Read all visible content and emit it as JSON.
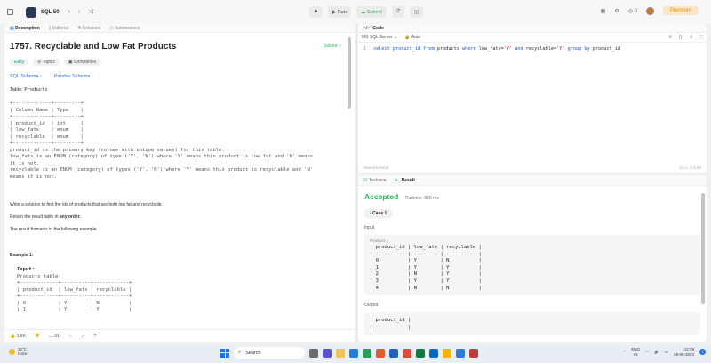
{
  "nav": {
    "title": "SQL 50",
    "run_label": "Run",
    "submit_label": "Submit",
    "streak": "0",
    "premium_label": "Premium"
  },
  "left": {
    "tabs": [
      "Description",
      "Editorial",
      "Solutions",
      "Submissions"
    ],
    "title": "1757. Recyclable and Low Fat Products",
    "solved": "Solved",
    "tags": [
      "Easy",
      "Topics",
      "Companies"
    ],
    "schemas": [
      "SQL Schema",
      "Pandas Schema"
    ],
    "table_label": "Table: ",
    "table_name": "Products",
    "schema_block": "+-------------+---------+\n| Column Name | Type    |\n+-------------+---------+\n| product_id  | int     |\n| low_fats    | enum    |\n| recyclable  | enum    |\n+-------------+---------+\nproduct_id is the primary key (column with unique values) for this table.\nlow_fats is an ENUM (category) of type ('Y', 'N') where 'Y' means this product is low fat and 'N' means\nit is not.\nrecyclable is an ENUM (category) of types ('Y', 'N') where 'Y' means this product is recyclable and 'N'\nmeans it is not.",
    "task": "Write a solution to find the ids of products that are both low fat and recyclable.",
    "order_pre": "Return the result table in ",
    "order_bold": "any order",
    "order_post": ".",
    "format": "The result format is in the following example.",
    "example_title": "Example 1:",
    "input_label": "Input:",
    "input_table_label": "Products table:",
    "example_block": "+-------------+----------+------------+\n| product_id  | low_fats | recyclable |\n+-------------+----------+------------+\n| 0           | Y        | N          |\n| 1           | Y        | Y          |",
    "likes": "1.6K",
    "comments": "91"
  },
  "code": {
    "tab": "Code",
    "language": "MS SQL Server",
    "mode": "Auto",
    "line_no": "1",
    "line_a": "select product_id ",
    "kw_from": "from",
    "line_b": " products ",
    "kw_where": "where",
    "line_c": " low_fats=",
    "str_y1": "'Y'",
    "line_d": " ",
    "kw_and": "and",
    "line_e": "  recyclable=",
    "str_y2": "'Y'",
    "line_f": " ",
    "kw_group": "group by",
    "line_g": "  product_id",
    "saved": "Saved to local",
    "position": "Ln 1, Col 56"
  },
  "result": {
    "tabs": [
      "Testcase",
      "Result"
    ],
    "status": "Accepted",
    "runtime": "Runtime: 820 ms",
    "case": "Case 1",
    "input_label": "Input",
    "products_hdr": "Products =",
    "input_table": "| product_id | low_fats | recyclable |\n| ---------- | -------- | ---------- |\n| 0          | Y        | N          |\n| 1          | Y        | Y          |\n| 2          | N        | Y          |\n| 3          | Y        | Y          |\n| 4          | N        | N          |",
    "output_label": "Output",
    "output_table": "| product_id |\n| ---------- |"
  },
  "taskbar": {
    "temp": "32°C",
    "weather": "Haze",
    "search": "Search",
    "lang1": "ENG",
    "lang2": "IN",
    "time": "12:39",
    "date": "29-09-2023",
    "notif": "1"
  }
}
